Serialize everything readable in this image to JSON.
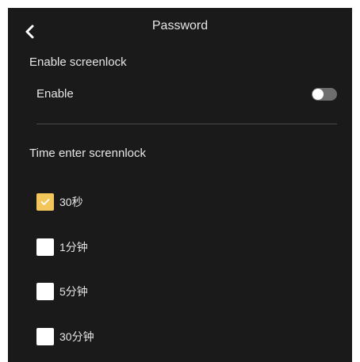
{
  "header": {
    "title": "Password"
  },
  "screenlock": {
    "section_label": "Enable screenlock",
    "enable_label": "Enable",
    "enabled": false
  },
  "time_section": {
    "label": "Time enter scrennlock",
    "options": [
      {
        "label": "30秒",
        "checked": true
      },
      {
        "label": "1分钟",
        "checked": false
      },
      {
        "label": "5分钟",
        "checked": false
      },
      {
        "label": "30分钟",
        "checked": false
      }
    ]
  },
  "colors": {
    "background": "#1a1a1a",
    "accent": "#f2c65b",
    "toggle_off": "#6e6e6e"
  },
  "icons": {
    "back": "chevron-left-icon",
    "check": "check-icon"
  }
}
